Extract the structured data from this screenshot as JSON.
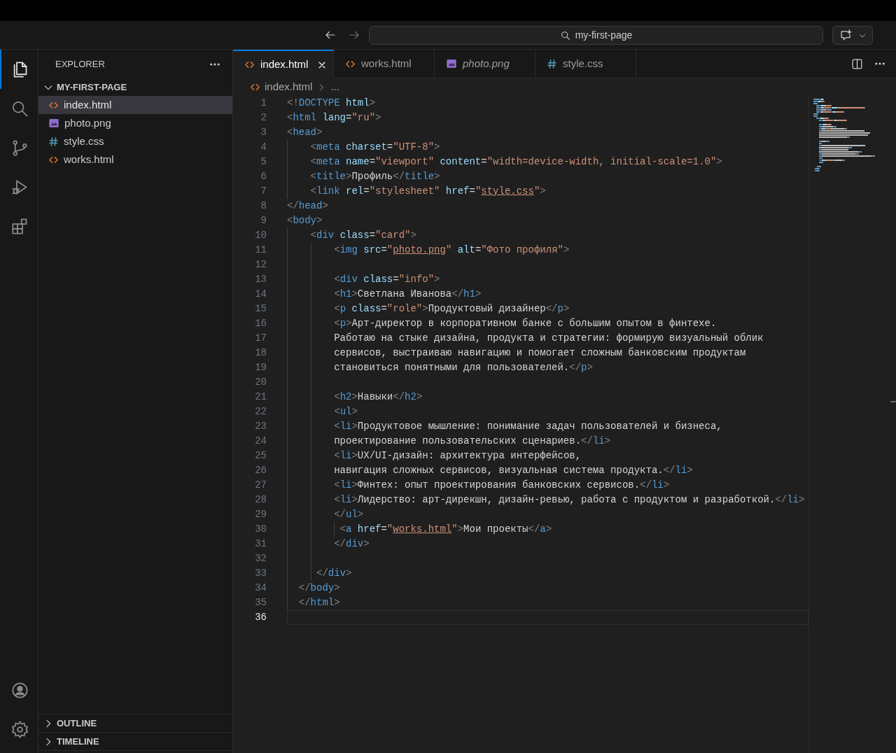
{
  "title_bar": {
    "back_enabled": true,
    "forward_enabled": false,
    "search": "my-first-page"
  },
  "activity_bar": [
    {
      "kind": "files",
      "selected": true
    },
    {
      "kind": "search",
      "selected": false
    },
    {
      "kind": "source-control",
      "selected": false
    },
    {
      "kind": "run",
      "selected": false
    },
    {
      "kind": "extensions",
      "selected": false
    },
    {
      "kind": "account",
      "selected": false
    },
    {
      "kind": "settings",
      "selected": false
    }
  ],
  "sidebar": {
    "title": "EXPLORER",
    "folder": {
      "name": "MY-FIRST-PAGE",
      "expanded": true
    },
    "files": [
      {
        "name": "index.html",
        "kind": "html",
        "selected": true
      },
      {
        "name": "photo.png",
        "kind": "image",
        "selected": false
      },
      {
        "name": "style.css",
        "kind": "css",
        "selected": false
      },
      {
        "name": "works.html",
        "kind": "html",
        "selected": false
      }
    ],
    "sections": [
      {
        "name": "OUTLINE",
        "expanded": false
      },
      {
        "name": "TIMELINE",
        "expanded": false
      }
    ]
  },
  "tabs": [
    {
      "label": "index.html",
      "kind": "html",
      "selected": true,
      "preview": false
    },
    {
      "label": "works.html",
      "kind": "html",
      "selected": false,
      "preview": false
    },
    {
      "label": "photo.png",
      "kind": "image",
      "selected": false,
      "preview": true
    },
    {
      "label": "style.css",
      "kind": "css",
      "selected": false,
      "preview": false
    }
  ],
  "breadcrumb": {
    "file": "index.html",
    "kind": "html",
    "rest": "..."
  },
  "lines": [
    {
      "n": "1",
      "current": false,
      "code": [
        {
          "kind": "punct",
          "text": "<!"
        },
        {
          "kind": "tag",
          "text": "DOCTYPE"
        },
        {
          "kind": "attr",
          "text": " html"
        },
        {
          "kind": "punct",
          "text": ">"
        }
      ]
    },
    {
      "n": "2",
      "current": false,
      "code": [
        {
          "kind": "punct",
          "text": "<"
        },
        {
          "kind": "tag",
          "text": "html"
        },
        {
          "kind": "attr",
          "text": " lang"
        },
        {
          "kind": "plain",
          "text": "="
        },
        {
          "kind": "string",
          "text": "\"ru\""
        },
        {
          "kind": "punct",
          "text": ">"
        }
      ]
    },
    {
      "n": "3",
      "current": false,
      "code": [
        {
          "kind": "punct",
          "text": "<"
        },
        {
          "kind": "tag",
          "text": "head"
        },
        {
          "kind": "punct",
          "text": ">"
        }
      ]
    },
    {
      "n": "4",
      "current": false,
      "code": [
        {
          "kind": "punct",
          "text": "    <"
        },
        {
          "kind": "tag",
          "text": "meta"
        },
        {
          "kind": "attr",
          "text": " charset"
        },
        {
          "kind": "plain",
          "text": "="
        },
        {
          "kind": "string",
          "text": "\"UTF-8\""
        },
        {
          "kind": "punct",
          "text": ">"
        }
      ]
    },
    {
      "n": "5",
      "current": false,
      "code": [
        {
          "kind": "punct",
          "text": "    <"
        },
        {
          "kind": "tag",
          "text": "meta"
        },
        {
          "kind": "attr",
          "text": " name"
        },
        {
          "kind": "plain",
          "text": "="
        },
        {
          "kind": "string",
          "text": "\"viewport\""
        },
        {
          "kind": "attr",
          "text": " content"
        },
        {
          "kind": "plain",
          "text": "="
        },
        {
          "kind": "string",
          "text": "\"width=device-width, initial-scale=1.0\""
        },
        {
          "kind": "punct",
          "text": ">"
        }
      ]
    },
    {
      "n": "6",
      "current": false,
      "code": [
        {
          "kind": "punct",
          "text": "    <"
        },
        {
          "kind": "tag",
          "text": "title"
        },
        {
          "kind": "punct",
          "text": ">"
        },
        {
          "kind": "plain",
          "text": "Профиль"
        },
        {
          "kind": "punct",
          "text": "</"
        },
        {
          "kind": "tag",
          "text": "title"
        },
        {
          "kind": "punct",
          "text": ">"
        }
      ]
    },
    {
      "n": "7",
      "current": false,
      "code": [
        {
          "kind": "punct",
          "text": "    <"
        },
        {
          "kind": "tag",
          "text": "link"
        },
        {
          "kind": "attr",
          "text": " rel"
        },
        {
          "kind": "plain",
          "text": "="
        },
        {
          "kind": "string",
          "text": "\"stylesheet\""
        },
        {
          "kind": "attr",
          "text": " href"
        },
        {
          "kind": "plain",
          "text": "="
        },
        {
          "kind": "string",
          "text": "\""
        },
        {
          "kind": "link",
          "text": "style.css"
        },
        {
          "kind": "string",
          "text": "\""
        },
        {
          "kind": "punct",
          "text": ">"
        }
      ]
    },
    {
      "n": "8",
      "current": false,
      "code": [
        {
          "kind": "punct",
          "text": "</"
        },
        {
          "kind": "tag",
          "text": "head"
        },
        {
          "kind": "punct",
          "text": ">"
        }
      ]
    },
    {
      "n": "9",
      "current": false,
      "code": [
        {
          "kind": "punct",
          "text": "<"
        },
        {
          "kind": "tag",
          "text": "body"
        },
        {
          "kind": "punct",
          "text": ">"
        }
      ]
    },
    {
      "n": "10",
      "current": false,
      "code": [
        {
          "kind": "punct",
          "text": "    <"
        },
        {
          "kind": "tag",
          "text": "div"
        },
        {
          "kind": "attr",
          "text": " class"
        },
        {
          "kind": "plain",
          "text": "="
        },
        {
          "kind": "string",
          "text": "\"card\""
        },
        {
          "kind": "punct",
          "text": ">"
        }
      ]
    },
    {
      "n": "11",
      "current": false,
      "code": [
        {
          "kind": "punct",
          "text": "        <"
        },
        {
          "kind": "tag",
          "text": "img"
        },
        {
          "kind": "attr",
          "text": " src"
        },
        {
          "kind": "plain",
          "text": "="
        },
        {
          "kind": "string",
          "text": "\""
        },
        {
          "kind": "link",
          "text": "photo.png"
        },
        {
          "kind": "string",
          "text": "\""
        },
        {
          "kind": "attr",
          "text": " alt"
        },
        {
          "kind": "plain",
          "text": "="
        },
        {
          "kind": "string",
          "text": "\"Фото профиля\""
        },
        {
          "kind": "punct",
          "text": ">"
        }
      ]
    },
    {
      "n": "12",
      "current": false
    },
    {
      "n": "13",
      "current": false,
      "code": [
        {
          "kind": "punct",
          "text": "        <"
        },
        {
          "kind": "tag",
          "text": "div"
        },
        {
          "kind": "attr",
          "text": " class"
        },
        {
          "kind": "plain",
          "text": "="
        },
        {
          "kind": "string",
          "text": "\"info\""
        },
        {
          "kind": "punct",
          "text": ">"
        }
      ]
    },
    {
      "n": "14",
      "current": false,
      "code": [
        {
          "kind": "punct",
          "text": "        <"
        },
        {
          "kind": "tag",
          "text": "h1"
        },
        {
          "kind": "punct",
          "text": ">"
        },
        {
          "kind": "plain",
          "text": "Светлана Иванова"
        },
        {
          "kind": "punct",
          "text": "</"
        },
        {
          "kind": "tag",
          "text": "h1"
        },
        {
          "kind": "punct",
          "text": ">"
        }
      ]
    },
    {
      "n": "15",
      "current": false,
      "code": [
        {
          "kind": "punct",
          "text": "        <"
        },
        {
          "kind": "tag",
          "text": "p"
        },
        {
          "kind": "attr",
          "text": " class"
        },
        {
          "kind": "plain",
          "text": "="
        },
        {
          "kind": "string",
          "text": "\"role\""
        },
        {
          "kind": "punct",
          "text": ">"
        },
        {
          "kind": "plain",
          "text": "Продуктовый дизайнер"
        },
        {
          "kind": "punct",
          "text": "</"
        },
        {
          "kind": "tag",
          "text": "p"
        },
        {
          "kind": "punct",
          "text": ">"
        }
      ]
    },
    {
      "n": "16",
      "current": false,
      "code": [
        {
          "kind": "punct",
          "text": "        <"
        },
        {
          "kind": "tag",
          "text": "p"
        },
        {
          "kind": "punct",
          "text": ">"
        },
        {
          "kind": "plain",
          "text": "Арт-директор в корпоративном банке с большим опытом в финтехе."
        }
      ]
    },
    {
      "n": "17",
      "current": false,
      "code": [
        {
          "kind": "plain",
          "text": "        Работаю на стыке дизайна, продукта и стратегии: формирую визуальный облик"
        }
      ]
    },
    {
      "n": "18",
      "current": false,
      "code": [
        {
          "kind": "plain",
          "text": "        сервисов, выстраиваю навигацию и помогает сложным банковским продуктам"
        }
      ]
    },
    {
      "n": "19",
      "current": false,
      "code": [
        {
          "kind": "plain",
          "text": "        становиться понятными для пользователей."
        },
        {
          "kind": "punct",
          "text": "</"
        },
        {
          "kind": "tag",
          "text": "p"
        },
        {
          "kind": "punct",
          "text": ">"
        }
      ]
    },
    {
      "n": "20",
      "current": false
    },
    {
      "n": "21",
      "current": false,
      "code": [
        {
          "kind": "punct",
          "text": "        <"
        },
        {
          "kind": "tag",
          "text": "h2"
        },
        {
          "kind": "punct",
          "text": ">"
        },
        {
          "kind": "plain",
          "text": "Навыки"
        },
        {
          "kind": "punct",
          "text": "</"
        },
        {
          "kind": "tag",
          "text": "h2"
        },
        {
          "kind": "punct",
          "text": ">"
        }
      ]
    },
    {
      "n": "22",
      "current": false,
      "code": [
        {
          "kind": "punct",
          "text": "        <"
        },
        {
          "kind": "tag",
          "text": "ul"
        },
        {
          "kind": "punct",
          "text": ">"
        }
      ]
    },
    {
      "n": "23",
      "current": false,
      "code": [
        {
          "kind": "punct",
          "text": "        <"
        },
        {
          "kind": "tag",
          "text": "li"
        },
        {
          "kind": "punct",
          "text": ">"
        },
        {
          "kind": "plain",
          "text": "Продуктовое мышление: понимание задач пользователей и бизнеса,"
        }
      ]
    },
    {
      "n": "24",
      "current": false,
      "code": [
        {
          "kind": "plain",
          "text": "        проектирование пользовательских сценариев."
        },
        {
          "kind": "punct",
          "text": "</"
        },
        {
          "kind": "tag",
          "text": "li"
        },
        {
          "kind": "punct",
          "text": ">"
        }
      ]
    },
    {
      "n": "25",
      "current": false,
      "code": [
        {
          "kind": "punct",
          "text": "        <"
        },
        {
          "kind": "tag",
          "text": "li"
        },
        {
          "kind": "punct",
          "text": ">"
        },
        {
          "kind": "plain",
          "text": "UX/UI-дизайн: архитектура интерфейсов,"
        }
      ]
    },
    {
      "n": "26",
      "current": false,
      "code": [
        {
          "kind": "plain",
          "text": "        навигация сложных сервисов, визуальная система продукта."
        },
        {
          "kind": "punct",
          "text": "</"
        },
        {
          "kind": "tag",
          "text": "li"
        },
        {
          "kind": "punct",
          "text": ">"
        }
      ]
    },
    {
      "n": "27",
      "current": false,
      "code": [
        {
          "kind": "punct",
          "text": "        <"
        },
        {
          "kind": "tag",
          "text": "li"
        },
        {
          "kind": "punct",
          "text": ">"
        },
        {
          "kind": "plain",
          "text": "Финтех: опыт проектирования банковских сервисов."
        },
        {
          "kind": "punct",
          "text": "</"
        },
        {
          "kind": "tag",
          "text": "li"
        },
        {
          "kind": "punct",
          "text": ">"
        }
      ]
    },
    {
      "n": "28",
      "current": false,
      "code": [
        {
          "kind": "punct",
          "text": "        <"
        },
        {
          "kind": "tag",
          "text": "li"
        },
        {
          "kind": "punct",
          "text": ">"
        },
        {
          "kind": "plain",
          "text": "Лидерство: арт-дирекшн, дизайн-ревью, работа с продуктом и разработкой."
        },
        {
          "kind": "punct",
          "text": "</"
        },
        {
          "kind": "tag",
          "text": "li"
        },
        {
          "kind": "punct",
          "text": ">"
        }
      ]
    },
    {
      "n": "29",
      "current": false,
      "code": [
        {
          "kind": "punct",
          "text": "        </"
        },
        {
          "kind": "tag",
          "text": "ul"
        },
        {
          "kind": "punct",
          "text": ">"
        }
      ]
    },
    {
      "n": "30",
      "current": false,
      "code": [
        {
          "kind": "punct",
          "text": "         <"
        },
        {
          "kind": "tag",
          "text": "a"
        },
        {
          "kind": "attr",
          "text": " href"
        },
        {
          "kind": "plain",
          "text": "="
        },
        {
          "kind": "string",
          "text": "\""
        },
        {
          "kind": "link",
          "text": "works.html"
        },
        {
          "kind": "string",
          "text": "\""
        },
        {
          "kind": "punct",
          "text": ">"
        },
        {
          "kind": "plain",
          "text": "Мои проекты"
        },
        {
          "kind": "punct",
          "text": "</"
        },
        {
          "kind": "tag",
          "text": "a"
        },
        {
          "kind": "punct",
          "text": ">"
        }
      ]
    },
    {
      "n": "31",
      "current": false,
      "code": [
        {
          "kind": "punct",
          "text": "        </"
        },
        {
          "kind": "tag",
          "text": "div"
        },
        {
          "kind": "punct",
          "text": ">"
        }
      ]
    },
    {
      "n": "32",
      "current": false
    },
    {
      "n": "33",
      "current": false,
      "code": [
        {
          "kind": "punct",
          "text": "     </"
        },
        {
          "kind": "tag",
          "text": "div"
        },
        {
          "kind": "punct",
          "text": ">"
        }
      ]
    },
    {
      "n": "34",
      "current": false,
      "code": [
        {
          "kind": "punct",
          "text": "  </"
        },
        {
          "kind": "tag",
          "text": "body"
        },
        {
          "kind": "punct",
          "text": ">"
        }
      ]
    },
    {
      "n": "35",
      "current": false,
      "code": [
        {
          "kind": "punct",
          "text": "  </"
        },
        {
          "kind": "tag",
          "text": "html"
        },
        {
          "kind": "punct",
          "text": ">"
        }
      ]
    },
    {
      "n": "36",
      "current": true
    }
  ]
}
